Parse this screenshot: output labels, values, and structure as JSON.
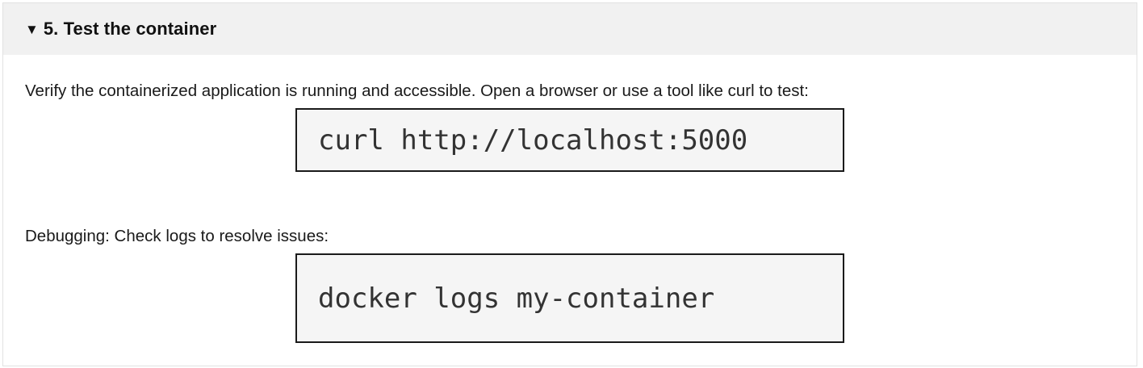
{
  "section": {
    "toggle_glyph": "▼",
    "title": "5. Test the container"
  },
  "content": {
    "intro_text": "Verify the containerized application is running and accessible. Open a browser or use a tool like curl to test:",
    "code_test": "curl http://localhost:5000",
    "debug_text": "Debugging: Check logs to resolve issues:",
    "code_logs": "docker logs my-container"
  }
}
